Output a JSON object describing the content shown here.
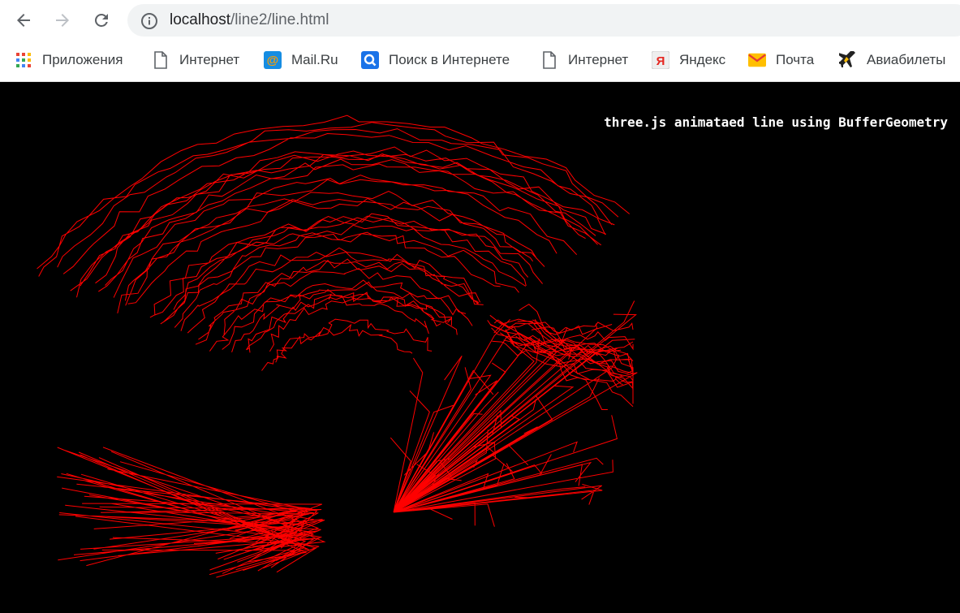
{
  "browser": {
    "url_host": "localhost",
    "url_path": "/line2/line.html"
  },
  "bookmarks": [
    {
      "label": "Приложения",
      "icon": "apps-grid-icon"
    },
    {
      "label": "Интернет",
      "icon": "page-icon"
    },
    {
      "label": "Mail.Ru",
      "icon": "mailru-icon"
    },
    {
      "label": "Поиск в Интернете",
      "icon": "search-icon"
    },
    {
      "label": "Интернет",
      "icon": "page-icon"
    },
    {
      "label": "Яндекс",
      "icon": "yandex-icon"
    },
    {
      "label": "Почта",
      "icon": "mail-envelope-icon"
    },
    {
      "label": "Авиабилеты",
      "icon": "airplane-icon"
    }
  ],
  "page": {
    "info_text": "three.js animataed line using BufferGeometry",
    "line_color": "#ff0000",
    "background_color": "#000000"
  }
}
